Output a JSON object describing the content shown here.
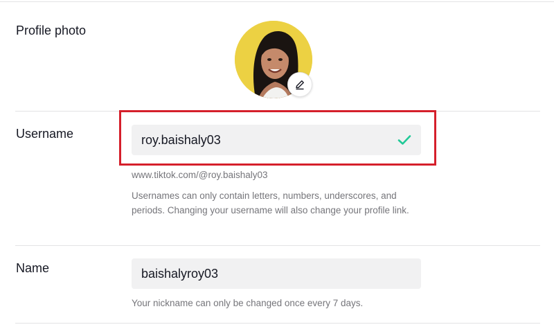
{
  "profile_photo": {
    "label": "Profile photo",
    "edit_icon": "pencil-icon"
  },
  "username": {
    "label": "Username",
    "value": "roy.baishaly03",
    "status_icon": "check-icon",
    "status_color": "#20c997",
    "profile_link": "www.tiktok.com/@roy.baishaly03",
    "hint": "Usernames can only contain letters, numbers, underscores, and periods. Changing your username will also change your profile link."
  },
  "name": {
    "label": "Name",
    "value": "baishalyroy03",
    "hint": "Your nickname can only be changed once every 7 days."
  },
  "colors": {
    "highlight": "#d51f2b",
    "avatar_bg": "#ecd143"
  }
}
